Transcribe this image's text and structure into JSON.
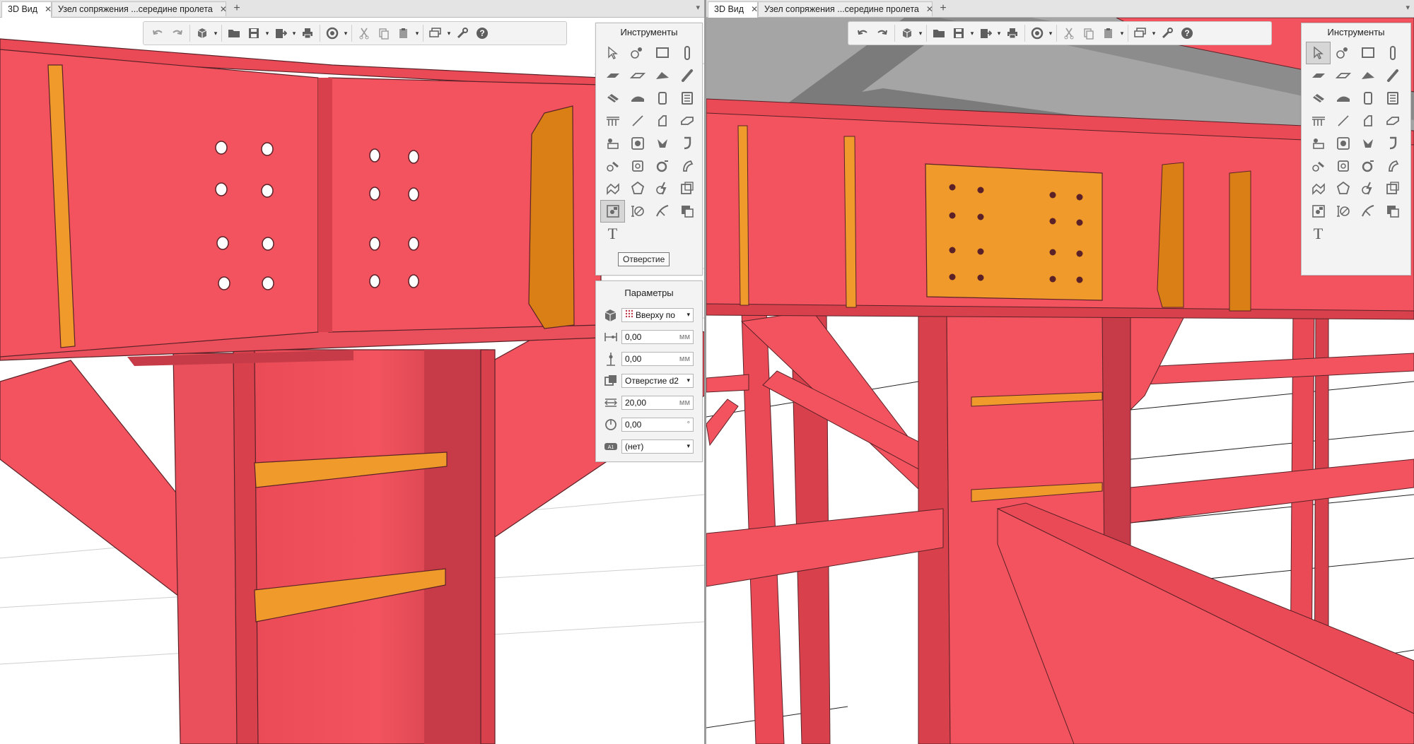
{
  "left_pane": {
    "tabs": [
      {
        "label": "3D Вид",
        "active": true
      },
      {
        "label": "Узел сопряжения ...середине пролета",
        "active": false
      }
    ],
    "tab_close_glyph": "✕",
    "tab_add_glyph": "+",
    "tab_menu_glyph": "▾"
  },
  "right_pane": {
    "tabs": [
      {
        "label": "3D Вид",
        "active": true
      },
      {
        "label": "Узел сопряжения ...середине пролета",
        "active": false
      }
    ],
    "tab_close_glyph": "✕",
    "tab_add_glyph": "+",
    "tab_menu_glyph": "▾"
  },
  "toolbar": {
    "buttons": [
      "undo-icon",
      "redo-icon",
      "view-cube-icon",
      "open-folder-icon",
      "save-icon",
      "export-icon",
      "print-icon",
      "render-icon",
      "cut-icon",
      "copy-icon",
      "paste-icon",
      "layers-icon",
      "wrench-icon",
      "help-icon"
    ],
    "caret_glyph": "▾"
  },
  "tools_panel": {
    "title": "Инструменты",
    "selected_index_left": 28,
    "selected_index_right": 0,
    "tooltip": "Отверстие",
    "text_tool_glyph": "T"
  },
  "params_panel": {
    "title": "Параметры",
    "rows": [
      {
        "icon": "placement-icon",
        "value": "Вверху по",
        "type": "dropdown",
        "prefix_icon": "grid-dots-icon"
      },
      {
        "icon": "offset-x-icon",
        "value": "0,00",
        "unit": "мм",
        "type": "number"
      },
      {
        "icon": "offset-y-icon",
        "value": "0,00",
        "unit": "мм",
        "type": "number"
      },
      {
        "icon": "hole-type-icon",
        "value": "Отверстие d2",
        "type": "dropdown"
      },
      {
        "icon": "diameter-icon",
        "value": "20,00",
        "unit": "мм",
        "type": "number"
      },
      {
        "icon": "rotation-icon",
        "value": "0,00",
        "unit": "°",
        "type": "number"
      },
      {
        "icon": "label-icon",
        "value": "(нет)",
        "type": "dropdown"
      }
    ]
  },
  "colors": {
    "steel": "#f2535e",
    "steel_dark": "#d8404c",
    "steel_shadow": "#c63b47",
    "plate": "#ef9a2a",
    "plate_dark": "#d97f16",
    "slab": "#7b7b7b",
    "slab_light": "#a5a5a5",
    "edge": "#5a2228"
  }
}
